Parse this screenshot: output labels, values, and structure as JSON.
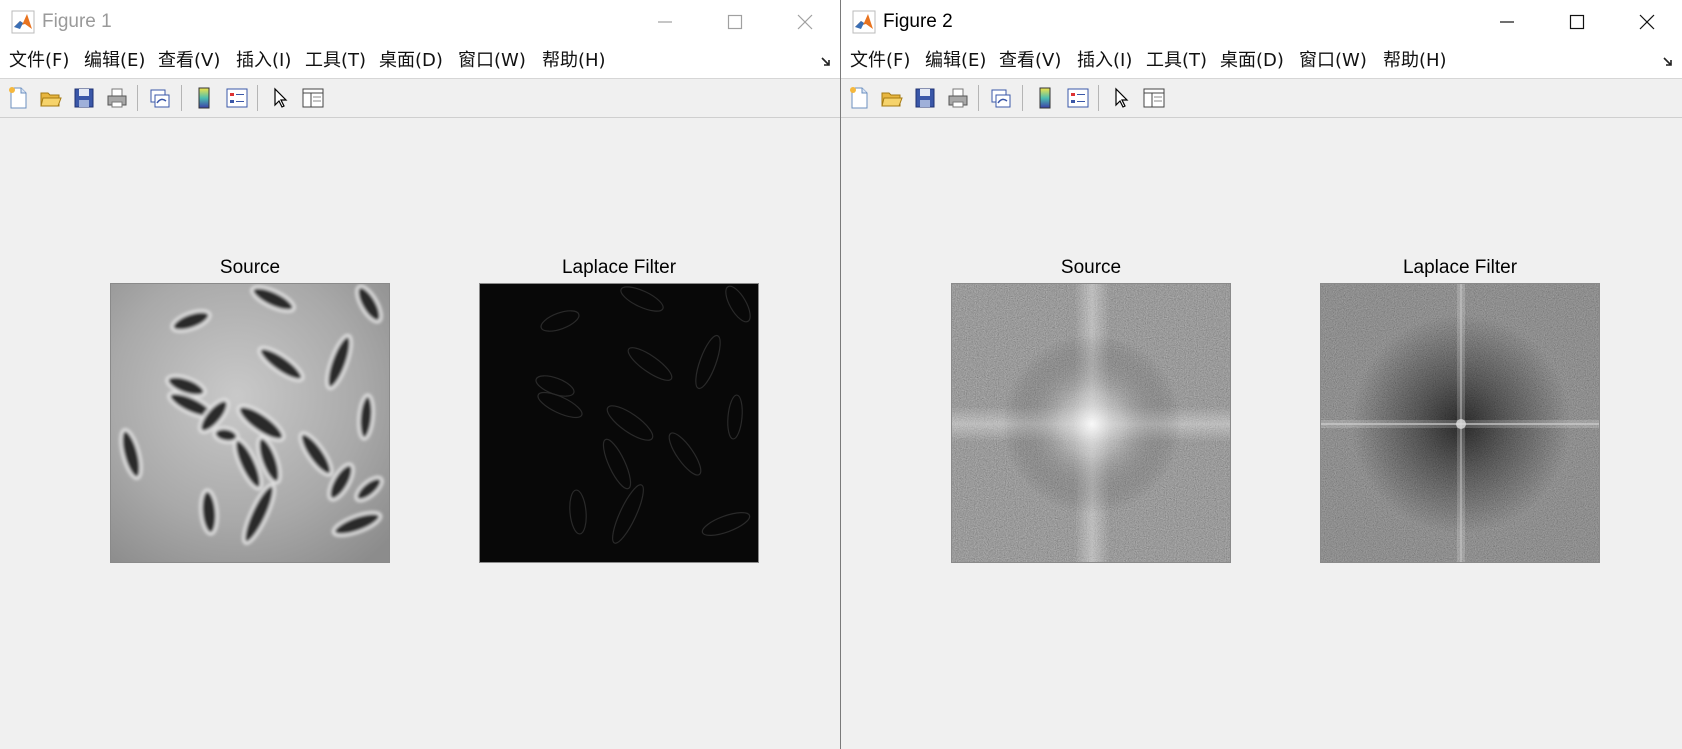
{
  "menu_labels": [
    "文件(F)",
    "编辑(E)",
    "查看(V)",
    "插入(I)",
    "工具(T)",
    "桌面(D)",
    "窗口(W)",
    "帮助(H)"
  ],
  "windows": [
    {
      "title": "Figure 1",
      "active": false,
      "axes": [
        {
          "title": "Source",
          "content": "phase-contrast microscope image of rod-shaped bacteria"
        },
        {
          "title": "Laplace Filter",
          "content": "near-black Laplacian edge response"
        }
      ]
    },
    {
      "title": "Figure 2",
      "active": true,
      "axes": [
        {
          "title": "Source",
          "content": "log-magnitude Fourier spectrum (noisy, bright centre, cross)"
        },
        {
          "title": "Laplace Filter",
          "content": "log-magnitude Fourier spectrum of filtered image (dark, thin cross)"
        }
      ]
    }
  ],
  "toolbar_icons": [
    "new-figure-icon",
    "open-file-icon",
    "save-icon",
    "print-icon",
    "link-plot-icon",
    "colorbar-icon",
    "legend-icon",
    "edit-plot-arrow-icon",
    "property-inspector-icon"
  ],
  "colors": {
    "background": "#f0f0f0",
    "titlebar": "#ffffff",
    "inactive_title": "#9a9a9a"
  }
}
